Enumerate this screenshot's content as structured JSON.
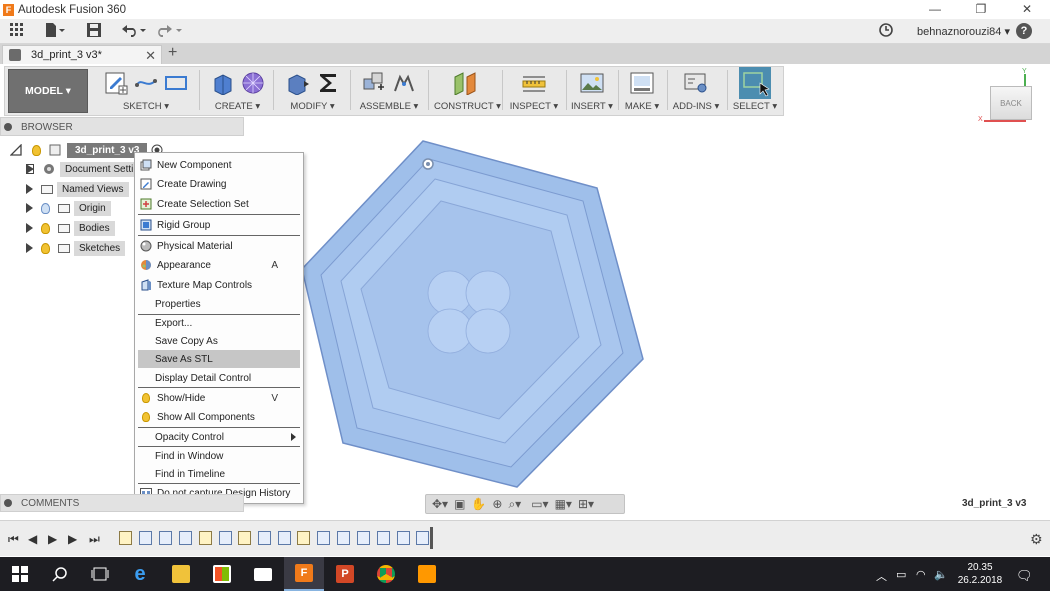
{
  "window": {
    "title": "Autodesk Fusion 360",
    "app_icon_letter": "F"
  },
  "quick_access": {
    "username": "behnaznorouzi84 ▾"
  },
  "document_tab": {
    "name": "3d_print_3 v3*"
  },
  "toolbar": {
    "workspace": "MODEL ▾",
    "groups": [
      {
        "label": "SKETCH ▾"
      },
      {
        "label": "CREATE ▾"
      },
      {
        "label": "MODIFY ▾"
      },
      {
        "label": "ASSEMBLE ▾"
      },
      {
        "label": "CONSTRUCT ▾"
      },
      {
        "label": "INSPECT ▾"
      },
      {
        "label": "INSERT ▾"
      },
      {
        "label": "MAKE ▾"
      },
      {
        "label": "ADD-INS ▾"
      },
      {
        "label": "SELECT ▾"
      }
    ]
  },
  "viewcube": {
    "face": "BACK",
    "axis_y": "Y",
    "axis_x": "X"
  },
  "browser": {
    "title": "BROWSER",
    "root": "3d_print_3 v3",
    "nodes": [
      {
        "label": "Document Settin"
      },
      {
        "label": "Named Views"
      },
      {
        "label": "Origin"
      },
      {
        "label": "Bodies"
      },
      {
        "label": "Sketches"
      }
    ]
  },
  "context_menu": {
    "items": [
      {
        "label": "New Component",
        "icon": "new-component-icon"
      },
      {
        "label": "Create Drawing",
        "icon": "drawing-icon"
      },
      {
        "label": "Create Selection Set",
        "icon": "selection-set-icon"
      },
      {
        "label": "Rigid Group",
        "icon": "rigid-group-icon"
      },
      {
        "label": "Physical Material",
        "icon": "material-icon"
      },
      {
        "label": "Appearance",
        "icon": "appearance-icon",
        "shortcut": "A"
      },
      {
        "label": "Texture Map Controls",
        "icon": "texture-icon"
      },
      {
        "label": "Properties"
      },
      {
        "label": "Export..."
      },
      {
        "label": "Save Copy As"
      },
      {
        "label": "Save As STL",
        "highlighted": true
      },
      {
        "label": "Display Detail Control"
      },
      {
        "label": "Show/Hide",
        "icon": "bulb-icon",
        "shortcut": "V"
      },
      {
        "label": "Show All Components",
        "icon": "bulb-icon"
      },
      {
        "label": "Opacity Control",
        "submenu": true
      },
      {
        "label": "Find in Window"
      },
      {
        "label": "Find in Timeline"
      },
      {
        "label": "Do not capture Design History",
        "icon": "history-icon"
      }
    ]
  },
  "comments": {
    "title": "COMMENTS"
  },
  "status": {
    "document_name": "3d_print_3 v3"
  },
  "taskbar": {
    "time": "20.35",
    "date": "26.2.2018"
  },
  "colors": {
    "model_fill": "#9fbfea",
    "model_edge": "#6f8fc8",
    "accent_select": "#4c8db0"
  }
}
